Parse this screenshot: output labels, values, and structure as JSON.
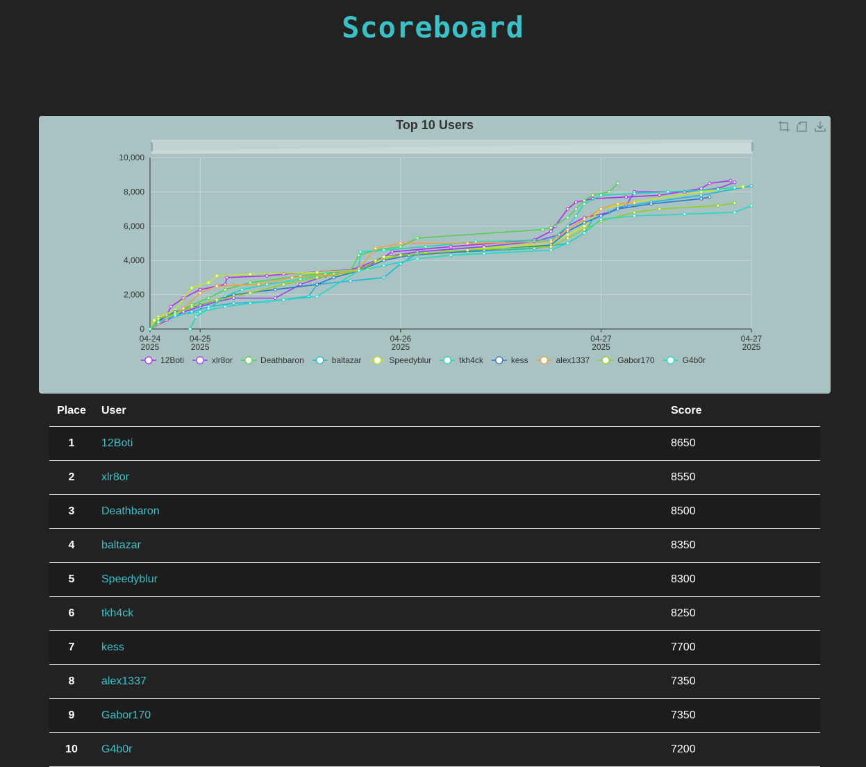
{
  "page": {
    "title": "Scoreboard"
  },
  "chart": {
    "toolbox": [
      "zoom-icon",
      "zoom-reset-icon",
      "download-icon"
    ]
  },
  "chart_data": {
    "type": "line",
    "title": "Top 10 Users",
    "xlabel": "",
    "ylabel": "",
    "ylim": [
      0,
      10000
    ],
    "y_ticks": [
      0,
      2000,
      4000,
      6000,
      8000,
      10000
    ],
    "x_ticks": [
      "04-24 2025",
      "04-25 2025",
      "04-26 2025",
      "04-27 2025",
      "04-27 2025"
    ],
    "x_range_hours": [
      0,
      72
    ],
    "grid": true,
    "legend_position": "bottom",
    "series": [
      {
        "name": "12Boti",
        "color": "#b02cf0",
        "points": [
          [
            0,
            0
          ],
          [
            1,
            400
          ],
          [
            2,
            800
          ],
          [
            2.5,
            1300
          ],
          [
            4,
            1800
          ],
          [
            6,
            2300
          ],
          [
            9,
            2600
          ],
          [
            9.2,
            3000
          ],
          [
            14,
            3100
          ],
          [
            16,
            3200
          ],
          [
            25,
            3500
          ],
          [
            27,
            3900
          ],
          [
            29,
            4500
          ],
          [
            36,
            4800
          ],
          [
            46,
            5200
          ],
          [
            48,
            5700
          ],
          [
            48.5,
            6000
          ],
          [
            50,
            7000
          ],
          [
            51,
            7400
          ],
          [
            53,
            7600
          ],
          [
            57,
            7700
          ],
          [
            61,
            7800
          ],
          [
            66,
            8200
          ],
          [
            67,
            8500
          ],
          [
            69.5,
            8650
          ]
        ]
      },
      {
        "name": "xlr8or",
        "color": "#9b3cf0",
        "points": [
          [
            0,
            0
          ],
          [
            2,
            500
          ],
          [
            4,
            1000
          ],
          [
            6,
            1300
          ],
          [
            8,
            1600
          ],
          [
            10,
            1800
          ],
          [
            15,
            1800
          ],
          [
            18,
            2600
          ],
          [
            21,
            3100
          ],
          [
            25,
            3600
          ],
          [
            28,
            4200
          ],
          [
            32,
            4500
          ],
          [
            40,
            4800
          ],
          [
            46,
            5100
          ],
          [
            49,
            5500
          ],
          [
            50,
            6000
          ],
          [
            52,
            6500
          ],
          [
            55,
            6800
          ],
          [
            57,
            7200
          ],
          [
            58,
            8000
          ],
          [
            64,
            8000
          ],
          [
            68,
            8200
          ],
          [
            70,
            8550
          ]
        ]
      },
      {
        "name": "Deathbaron",
        "color": "#4ed04e",
        "points": [
          [
            0,
            0
          ],
          [
            1,
            300
          ],
          [
            3,
            900
          ],
          [
            5,
            1400
          ],
          [
            7,
            1800
          ],
          [
            9,
            2300
          ],
          [
            12,
            2700
          ],
          [
            18,
            3100
          ],
          [
            24,
            3400
          ],
          [
            25,
            4300
          ],
          [
            27,
            4600
          ],
          [
            30,
            4800
          ],
          [
            32,
            5300
          ],
          [
            47,
            5800
          ],
          [
            48,
            5900
          ],
          [
            50,
            6500
          ],
          [
            51,
            7000
          ],
          [
            52,
            7500
          ],
          [
            53,
            7800
          ],
          [
            55,
            8000
          ],
          [
            56,
            8500
          ]
        ]
      },
      {
        "name": "baltazar",
        "color": "#1cb8d8",
        "points": [
          [
            0,
            0
          ],
          [
            2,
            600
          ],
          [
            5,
            1000
          ],
          [
            7,
            1300
          ],
          [
            10,
            1500
          ],
          [
            14,
            1600
          ],
          [
            19,
            1900
          ],
          [
            20,
            2600
          ],
          [
            24,
            2800
          ],
          [
            28,
            3000
          ],
          [
            30,
            3800
          ],
          [
            32,
            4400
          ],
          [
            38,
            4500
          ],
          [
            46,
            4700
          ],
          [
            50,
            5000
          ],
          [
            52,
            5600
          ],
          [
            53,
            6400
          ],
          [
            55,
            6800
          ],
          [
            56,
            7100
          ],
          [
            60,
            7400
          ],
          [
            66,
            7800
          ],
          [
            72,
            8350
          ]
        ]
      },
      {
        "name": "Speedyblur",
        "color": "#c4e820",
        "points": [
          [
            0,
            0
          ],
          [
            0.5,
            500
          ],
          [
            1,
            700
          ],
          [
            3,
            1100
          ],
          [
            5,
            2400
          ],
          [
            7,
            2700
          ],
          [
            8,
            3100
          ],
          [
            12,
            3200
          ],
          [
            20,
            3300
          ],
          [
            26,
            3500
          ],
          [
            28,
            4200
          ],
          [
            33,
            4400
          ],
          [
            40,
            4700
          ],
          [
            48,
            5000
          ],
          [
            50,
            5500
          ],
          [
            52,
            6000
          ],
          [
            54,
            7000
          ],
          [
            58,
            7400
          ],
          [
            66,
            8000
          ],
          [
            71,
            8300
          ]
        ]
      },
      {
        "name": "tkh4ck",
        "color": "#20d8b8",
        "points": [
          [
            4.8,
            0
          ],
          [
            5.5,
            700
          ],
          [
            7,
            1200
          ],
          [
            9,
            1900
          ],
          [
            11,
            2300
          ],
          [
            14,
            2600
          ],
          [
            18,
            2900
          ],
          [
            21,
            3200
          ],
          [
            25,
            3500
          ],
          [
            25.2,
            4500
          ],
          [
            28,
            4600
          ],
          [
            33,
            4800
          ],
          [
            39,
            5100
          ],
          [
            48,
            5200
          ],
          [
            50,
            6000
          ],
          [
            51,
            6600
          ],
          [
            52,
            7300
          ],
          [
            54,
            7800
          ],
          [
            58,
            7900
          ],
          [
            62,
            8000
          ],
          [
            68,
            8150
          ],
          [
            70,
            8250
          ]
        ]
      },
      {
        "name": "kess",
        "color": "#2878d0",
        "points": [
          [
            0,
            0
          ],
          [
            1,
            500
          ],
          [
            3,
            1000
          ],
          [
            6,
            1400
          ],
          [
            10,
            2000
          ],
          [
            15,
            2300
          ],
          [
            20,
            2600
          ],
          [
            22,
            3000
          ],
          [
            25,
            3400
          ],
          [
            28,
            4000
          ],
          [
            31,
            4300
          ],
          [
            40,
            4600
          ],
          [
            48,
            4900
          ],
          [
            50,
            5700
          ],
          [
            52,
            6200
          ],
          [
            54,
            6600
          ],
          [
            56,
            7000
          ],
          [
            60,
            7300
          ],
          [
            66,
            7600
          ],
          [
            67,
            7700
          ]
        ]
      },
      {
        "name": "alex1337",
        "color": "#f0a040",
        "points": [
          [
            0,
            0
          ],
          [
            2,
            600
          ],
          [
            4,
            1200
          ],
          [
            6,
            2100
          ],
          [
            8,
            2500
          ],
          [
            13,
            2600
          ],
          [
            17,
            3000
          ],
          [
            22,
            3200
          ],
          [
            25,
            3500
          ],
          [
            27,
            4700
          ],
          [
            30,
            5000
          ],
          [
            38,
            5000
          ],
          [
            48,
            5100
          ],
          [
            50,
            5800
          ],
          [
            52,
            6400
          ],
          [
            54,
            7000
          ],
          [
            56,
            7300
          ],
          [
            58,
            7350
          ]
        ]
      },
      {
        "name": "Gabor170",
        "color": "#90d018",
        "points": [
          [
            0,
            0
          ],
          [
            1,
            600
          ],
          [
            3,
            900
          ],
          [
            5,
            1300
          ],
          [
            8,
            1700
          ],
          [
            12,
            2100
          ],
          [
            16,
            2600
          ],
          [
            20,
            3000
          ],
          [
            25,
            3400
          ],
          [
            27,
            4000
          ],
          [
            30,
            4300
          ],
          [
            38,
            4600
          ],
          [
            48,
            4800
          ],
          [
            50,
            5300
          ],
          [
            52,
            5800
          ],
          [
            54,
            6300
          ],
          [
            58,
            6800
          ],
          [
            61,
            7000
          ],
          [
            68,
            7200
          ],
          [
            70,
            7350
          ]
        ]
      },
      {
        "name": "G4b0r",
        "color": "#20d8c8",
        "points": [
          [
            0,
            0
          ],
          [
            1,
            400
          ],
          [
            3,
            800
          ],
          [
            6,
            1000
          ],
          [
            9,
            1300
          ],
          [
            12,
            1500
          ],
          [
            16,
            1700
          ],
          [
            20,
            1900
          ],
          [
            25,
            3400
          ],
          [
            28,
            3700
          ],
          [
            32,
            4100
          ],
          [
            36,
            4300
          ],
          [
            40,
            4400
          ],
          [
            48,
            4600
          ],
          [
            50,
            5000
          ],
          [
            52,
            5600
          ],
          [
            54,
            6400
          ],
          [
            58,
            6600
          ],
          [
            64,
            6700
          ],
          [
            70,
            6800
          ],
          [
            72,
            7200
          ]
        ]
      }
    ]
  },
  "table": {
    "headers": {
      "place": "Place",
      "user": "User",
      "score": "Score"
    },
    "rows": [
      {
        "place": "1",
        "user": "12Boti",
        "score": "8650"
      },
      {
        "place": "2",
        "user": "xlr8or",
        "score": "8550"
      },
      {
        "place": "3",
        "user": "Deathbaron",
        "score": "8500"
      },
      {
        "place": "4",
        "user": "baltazar",
        "score": "8350"
      },
      {
        "place": "5",
        "user": "Speedyblur",
        "score": "8300"
      },
      {
        "place": "6",
        "user": "tkh4ck",
        "score": "8250"
      },
      {
        "place": "7",
        "user": "kess",
        "score": "7700"
      },
      {
        "place": "8",
        "user": "alex1337",
        "score": "7350"
      },
      {
        "place": "9",
        "user": "Gabor170",
        "score": "7350"
      },
      {
        "place": "10",
        "user": "G4b0r",
        "score": "7200"
      }
    ]
  }
}
